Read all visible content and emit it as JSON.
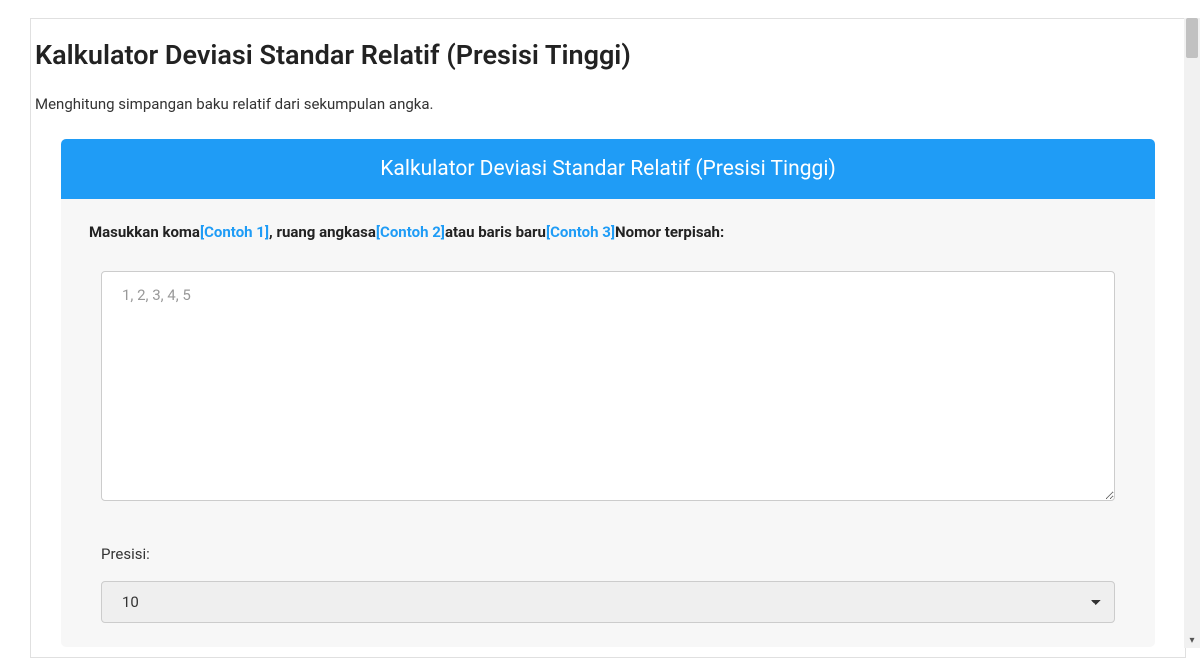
{
  "page": {
    "title": "Kalkulator Deviasi Standar Relatif (Presisi Tinggi)",
    "description": "Menghitung simpangan baku relatif dari sekumpulan angka."
  },
  "panel": {
    "header": "Kalkulator Deviasi Standar Relatif (Presisi Tinggi)"
  },
  "inputLabel": {
    "part1": "Masukkan koma",
    "example1": "[Contoh 1]",
    "part2": ", ruang angkasa",
    "example2": "[Contoh 2]",
    "part3": "atau baris baru",
    "example3": "[Contoh 3]",
    "part4": "Nomor terpisah:"
  },
  "textarea": {
    "placeholder": "1, 2, 3, 4, 5",
    "value": ""
  },
  "precision": {
    "label": "Presisi:",
    "selected": "10"
  }
}
